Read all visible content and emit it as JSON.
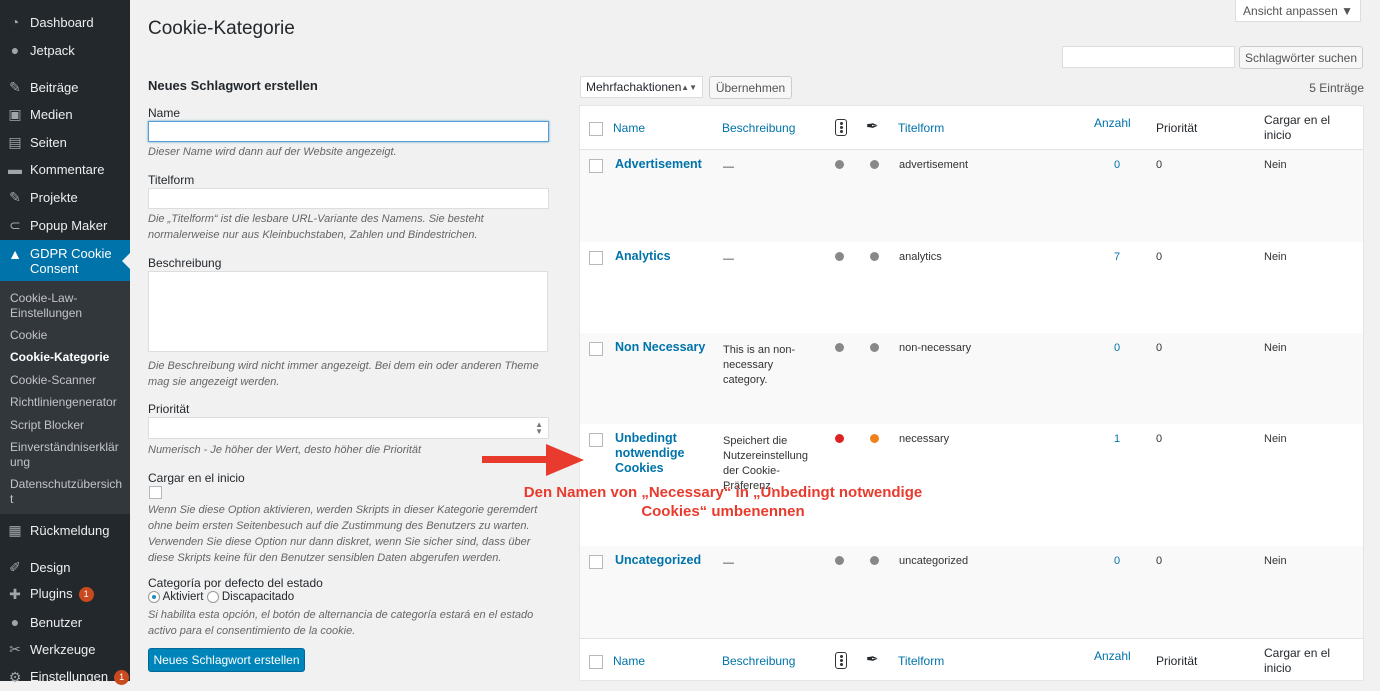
{
  "sidebar": {
    "items": [
      {
        "label": "Dashboard",
        "icon": "dashboard-icon"
      },
      {
        "label": "Jetpack",
        "icon": "jetpack-icon"
      },
      {
        "label": "Beiträge",
        "icon": "pin-icon"
      },
      {
        "label": "Medien",
        "icon": "media-icon"
      },
      {
        "label": "Seiten",
        "icon": "pages-icon"
      },
      {
        "label": "Kommentare",
        "icon": "comment-icon"
      },
      {
        "label": "Projekte",
        "icon": "pin-icon"
      },
      {
        "label": "Popup Maker",
        "icon": "popup-icon"
      }
    ],
    "gdpr": {
      "label": "GDPR Cookie Consent",
      "icon": "lock-icon"
    },
    "submenu": [
      "Cookie-Law-Einstellungen",
      "Cookie",
      "Cookie-Kategorie",
      "Cookie-Scanner",
      "Richtliniengenerator",
      "Script Blocker",
      "Einverständniserklärung",
      "Datenschutzübersicht"
    ],
    "items2": [
      {
        "label": "Rückmeldung",
        "icon": "feedback-icon"
      },
      {
        "label": "Design",
        "icon": "brush-icon"
      },
      {
        "label": "Plugins",
        "icon": "plugin-icon",
        "badge": "1"
      },
      {
        "label": "Benutzer",
        "icon": "user-icon"
      },
      {
        "label": "Werkzeuge",
        "icon": "wrench-icon"
      },
      {
        "label": "Einstellungen",
        "icon": "settings-icon",
        "badge": "1"
      }
    ]
  },
  "header": {
    "title": "Cookie-Kategorie",
    "screen_options": "Ansicht anpassen ▼",
    "search_button": "Schlagwörter suchen"
  },
  "form": {
    "title": "Neues Schlagwort erstellen",
    "name_label": "Name",
    "name_hint": "Dieser Name wird dann auf der Website angezeigt.",
    "slug_label": "Titelform",
    "slug_hint": "Die „Titelform“ ist die lesbare URL-Variante des Namens. Sie besteht normalerweise nur aus Kleinbuchstaben, Zahlen und Bindestrichen.",
    "desc_label": "Beschreibung",
    "desc_hint": "Die Beschreibung wird nicht immer angezeigt. Bei dem ein oder anderen Theme mag sie angezeigt werden.",
    "prio_label": "Priorität",
    "prio_hint": "Numerisch - Je höher der Wert, desto höher die Priorität",
    "load_label": "Cargar en el inicio",
    "load_hint": "Wenn Sie diese Option aktivieren, werden Skripts in dieser Kategorie geremdert ohne beim ersten Seitenbesuch auf die Zustimmung des Benutzers zu warten. Verwenden Sie diese Option nur dann diskret, wenn Sie sicher sind, dass über diese Skripts keine für den Benutzer sensiblen Daten abgerufen werden.",
    "default_label": "Categoría por defecto del estado",
    "opt_active": "Aktiviert",
    "opt_disabled": "Discapacitado",
    "default_hint": "Si habilita esta opción, el botón de alternancia de categoría estará en el estado activo para el consentimiento de la cookie.",
    "submit": "Neues Schlagwort erstellen"
  },
  "table": {
    "bulk_action": "Mehrfachaktionen",
    "apply": "Übernehmen",
    "count": "5 Einträge",
    "columns": {
      "name": "Name",
      "desc": "Beschreibung",
      "slug": "Titelform",
      "count": "Anzahl",
      "priority": "Priorität",
      "load": "Cargar en el inicio"
    },
    "rows": [
      {
        "name": "Advertisement",
        "desc": "—",
        "slug": "advertisement",
        "count": "0",
        "priority": "0",
        "load": "Nein",
        "c1": "#888888",
        "c2": "#888888"
      },
      {
        "name": "Analytics",
        "desc": "—",
        "slug": "analytics",
        "count": "7",
        "priority": "0",
        "load": "Nein",
        "c1": "#888888",
        "c2": "#888888"
      },
      {
        "name": "Non Necessary",
        "desc": "This is an non-necessary category.",
        "slug": "non-necessary",
        "count": "0",
        "priority": "0",
        "load": "Nein",
        "c1": "#888888",
        "c2": "#888888"
      },
      {
        "name": "Unbedingt notwendige Cookies",
        "desc": "Speichert die Nutzereinstellung der Cookie-Präferenz.",
        "slug": "necessary",
        "count": "1",
        "priority": "0",
        "load": "Nein",
        "c1": "#dd2222",
        "c2": "#f0821e"
      },
      {
        "name": "Uncategorized",
        "desc": "—",
        "slug": "uncategorized",
        "count": "0",
        "priority": "0",
        "load": "Nein",
        "c1": "#888888",
        "c2": "#888888"
      }
    ]
  },
  "annotation": "Den Namen von „Necessary“ in „Unbedingt notwendige Cookies“ umbenennen",
  "colors": {
    "accent": "#0073aa",
    "annotation": "#e83a2d"
  }
}
